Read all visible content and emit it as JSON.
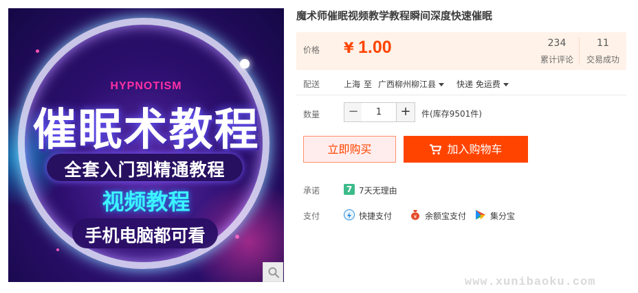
{
  "product_image": {
    "brand_text": "HYPNOTISM",
    "main_text": "催眠术教程",
    "sub_text": "全套入门到精通教程",
    "video_text": "视频教程",
    "device_text": "手机电脑都可看",
    "zoom_icon": "magnifier-icon"
  },
  "title": "魔术师催眠视频教学教程瞬间深度快速催眠",
  "price": {
    "label": "价格",
    "currency": "¥",
    "value": "1.00",
    "color": "#ff4400",
    "reviews_count": "234",
    "reviews_label": "累计评论",
    "sales_count": "11",
    "sales_label": "交易成功"
  },
  "shipping": {
    "label": "配送",
    "from": "上海",
    "to_word": "至",
    "destination": "广西柳州柳江县",
    "method": "快递 免运费"
  },
  "quantity": {
    "label": "数量",
    "minus": "−",
    "value": "1",
    "plus": "+",
    "stock": "件(库存9501件)"
  },
  "buttons": {
    "buy_now": "立即购买",
    "add_cart": "加入购物车"
  },
  "promise": {
    "label": "承诺",
    "text": "7天无理由",
    "icon_char": "7"
  },
  "payment": {
    "label": "支付",
    "methods": [
      "快捷支付",
      "余额宝支付",
      "集分宝"
    ]
  },
  "watermark": "www.xunibaoku.com"
}
